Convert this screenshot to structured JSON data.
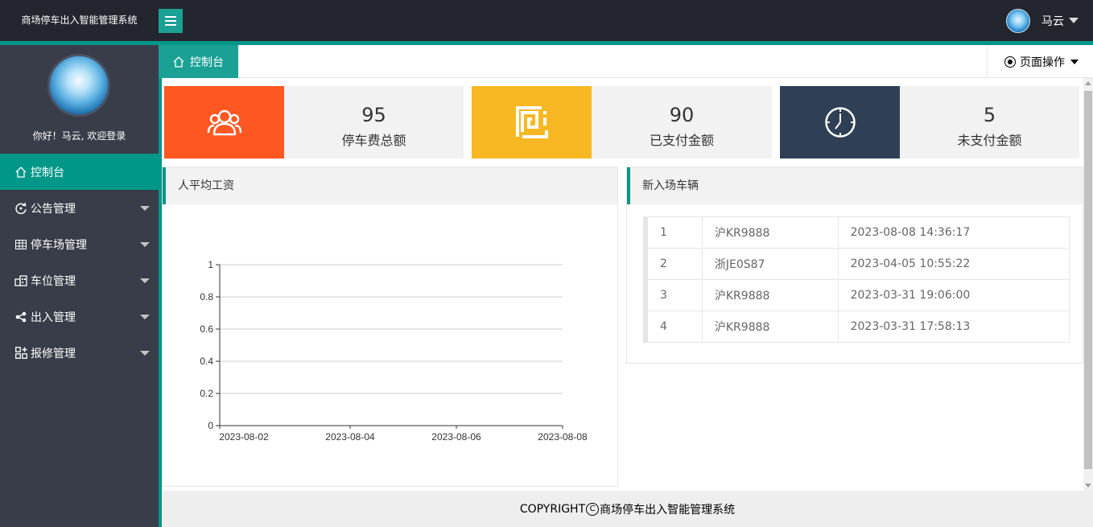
{
  "header": {
    "app_title": "商场停车出入智能管理系统",
    "user_name": "马云"
  },
  "sidebar": {
    "welcome": "你好！马云, 欢迎登录",
    "items": [
      {
        "label": "控制台",
        "icon": "home-icon",
        "active": true
      },
      {
        "label": "公告管理",
        "icon": "refresh-circle-icon"
      },
      {
        "label": "停车场管理",
        "icon": "grid-table-icon"
      },
      {
        "label": "车位管理",
        "icon": "building-icon"
      },
      {
        "label": "出入管理",
        "icon": "share-icon"
      },
      {
        "label": "报修管理",
        "icon": "app-grid-plus-icon"
      }
    ]
  },
  "tabs": {
    "home_label": "控制台",
    "page_ops_label": "页面操作"
  },
  "stats": [
    {
      "value": "95",
      "label": "停车费总额",
      "color": "#ff5722",
      "icon": "users-icon"
    },
    {
      "value": "90",
      "label": "已支付金额",
      "color": "#f7b824",
      "icon": "spiral-square-icon"
    },
    {
      "value": "5",
      "label": "未支付金额",
      "color": "#2f4056",
      "icon": "clock-icon"
    }
  ],
  "chart_panel": {
    "title": "人平均工资"
  },
  "chart_data": {
    "type": "line",
    "title": "",
    "xlabel": "",
    "ylabel": "",
    "categories": [
      "2023-08-02",
      "2023-08-04",
      "2023-08-06",
      "2023-08-08"
    ],
    "series": [],
    "ylim": [
      0,
      1
    ],
    "yticks": [
      "0",
      "0.2",
      "0.4",
      "0.6",
      "0.8",
      "1"
    ],
    "grid": true
  },
  "vehicles_panel": {
    "title": "新入场车辆",
    "rows": [
      {
        "no": "1",
        "plate": "沪KR9888",
        "time": "2023-08-08 14:36:17"
      },
      {
        "no": "2",
        "plate": "浙JE0S87",
        "time": "2023-04-05 10:55:22"
      },
      {
        "no": "3",
        "plate": "沪KR9888",
        "time": "2023-03-31 19:06:00"
      },
      {
        "no": "4",
        "plate": "沪KR9888",
        "time": "2023-03-31 17:58:13"
      }
    ]
  },
  "footer": {
    "prefix": "COPYRIGHT",
    "text": "商场停车出入智能管理系统"
  }
}
